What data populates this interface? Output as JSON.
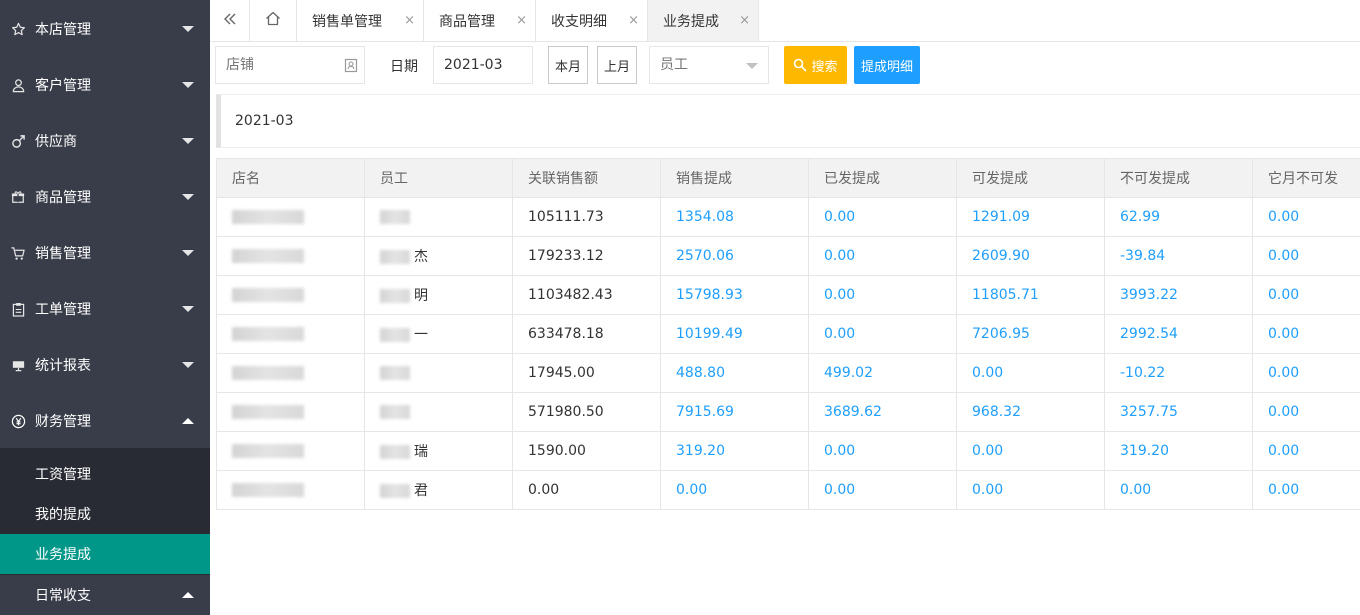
{
  "sidebar": {
    "items": [
      {
        "label": "本店管理",
        "icon": "star-icon"
      },
      {
        "label": "客户管理",
        "icon": "user-icon"
      },
      {
        "label": "供应商",
        "icon": "male-icon"
      },
      {
        "label": "商品管理",
        "icon": "gift-icon"
      },
      {
        "label": "销售管理",
        "icon": "cart-icon"
      },
      {
        "label": "工单管理",
        "icon": "clipboard-icon"
      },
      {
        "label": "统计报表",
        "icon": "chart-icon"
      },
      {
        "label": "财务管理",
        "icon": "yen-icon"
      }
    ],
    "subitems": [
      {
        "label": "工资管理"
      },
      {
        "label": "我的提成"
      },
      {
        "label": "业务提成"
      }
    ],
    "last_group": {
      "label": "日常收支"
    },
    "active_color": "#009688"
  },
  "tabs": [
    {
      "label": "销售单管理",
      "close": "×"
    },
    {
      "label": "商品管理",
      "close": "×"
    },
    {
      "label": "收支明细",
      "close": "×"
    },
    {
      "label": "业务提成",
      "close": "×"
    }
  ],
  "toolbar": {
    "store_placeholder": "店铺",
    "date_label": "日期",
    "date_value": "2021-03",
    "this_month": "本月",
    "last_month": "上月",
    "employee_placeholder": "员工",
    "search_label": "搜索",
    "detail_label": "提成明细",
    "search_color": "#ffb800",
    "detail_color": "#1e9fff"
  },
  "banner": {
    "text": "2021-03"
  },
  "table": {
    "headers": [
      "店名",
      "员工",
      "关联销售额",
      "销售提成",
      "已发提成",
      "可发提成",
      "不可发提成",
      "它月不可发"
    ],
    "rows": [
      {
        "store": "",
        "employee": "",
        "sales": "105111.73",
        "commission": "1354.08",
        "paid": "0.00",
        "payable": "1291.09",
        "unpayable": "62.99",
        "other_month": "0.00"
      },
      {
        "store": "",
        "employee": "杰",
        "sales": "179233.12",
        "commission": "2570.06",
        "paid": "0.00",
        "payable": "2609.90",
        "unpayable": "-39.84",
        "other_month": "0.00"
      },
      {
        "store": "",
        "employee": "明",
        "sales": "1103482.43",
        "commission": "15798.93",
        "paid": "0.00",
        "payable": "11805.71",
        "unpayable": "3993.22",
        "other_month": "0.00"
      },
      {
        "store": "",
        "employee": "一",
        "sales": "633478.18",
        "commission": "10199.49",
        "paid": "0.00",
        "payable": "7206.95",
        "unpayable": "2992.54",
        "other_month": "0.00"
      },
      {
        "store": "",
        "employee": "",
        "sales": "17945.00",
        "commission": "488.80",
        "paid": "499.02",
        "payable": "0.00",
        "unpayable": "-10.22",
        "other_month": "0.00"
      },
      {
        "store": "",
        "employee": "",
        "sales": "571980.50",
        "commission": "7915.69",
        "paid": "3689.62",
        "payable": "968.32",
        "unpayable": "3257.75",
        "other_month": "0.00"
      },
      {
        "store": "",
        "employee": "瑞",
        "sales": "1590.00",
        "commission": "319.20",
        "paid": "0.00",
        "payable": "0.00",
        "unpayable": "319.20",
        "other_month": "0.00"
      },
      {
        "store": "",
        "employee": "君",
        "sales": "0.00",
        "commission": "0.00",
        "paid": "0.00",
        "payable": "0.00",
        "unpayable": "0.00",
        "other_month": "0.00"
      }
    ]
  }
}
